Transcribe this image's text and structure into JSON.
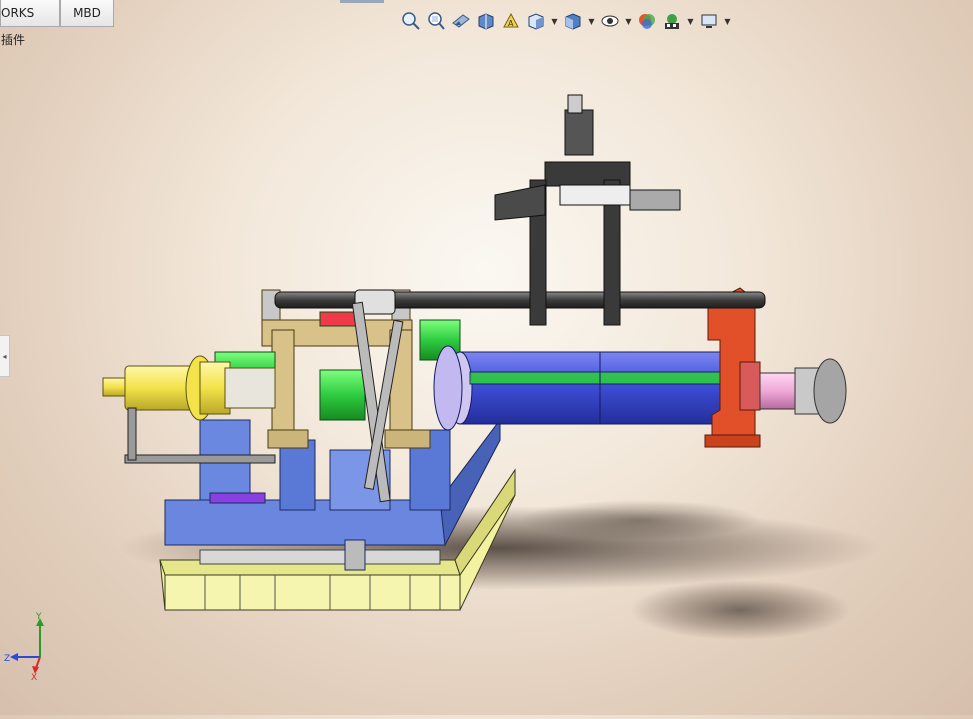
{
  "tabs": [
    {
      "label": "ORKS 插件"
    },
    {
      "label": "MBD"
    }
  ],
  "view_toolbar": {
    "icons": [
      "zoom-to-fit-icon",
      "zoom-to-area-icon",
      "previous-view-icon",
      "section-view-icon",
      "dynamic-annotation-view-icon",
      "view-orientation-icon",
      "display-style-icon",
      "hide-show-items-icon",
      "edit-appearance-icon",
      "apply-scene-icon",
      "view-settings-icon"
    ]
  },
  "triad": {
    "x_label": "X",
    "y_label": "Y",
    "z_label": "Z"
  },
  "colors": {
    "base_yellow": "#f2f2a0",
    "frame_blue": "#5a78d6",
    "cylinder_blue": "#3f4fd8",
    "bracket_tan": "#d8c28a",
    "gearbox_green": "#2ecc40",
    "support_red": "#e2502a",
    "hub_yellow": "#f3e24a",
    "dark_frame": "#3a3a3a"
  }
}
